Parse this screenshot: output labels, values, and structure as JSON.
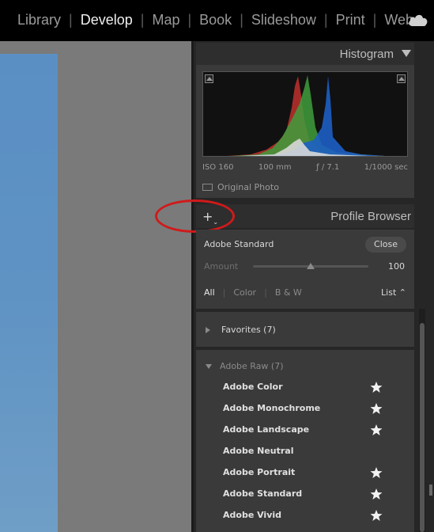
{
  "top_bar": {
    "modules": [
      {
        "label": "Library",
        "active": false
      },
      {
        "label": "Develop",
        "active": true
      },
      {
        "label": "Map",
        "active": false
      },
      {
        "label": "Book",
        "active": false
      },
      {
        "label": "Slideshow",
        "active": false
      },
      {
        "label": "Print",
        "active": false
      },
      {
        "label": "Web",
        "active": false
      }
    ],
    "cloud_icon": "cloud-icon"
  },
  "histogram": {
    "title": "Histogram",
    "iso": "ISO 160",
    "focal_length": "100 mm",
    "aperture": "ƒ / 7.1",
    "shutter": "1/1000 sec",
    "original_photo_label": "Original Photo"
  },
  "profile_browser": {
    "title": "Profile Browser",
    "add_icon": "plus-icon",
    "current_profile": "Adobe Standard",
    "close_label": "Close",
    "amount_label": "Amount",
    "amount_value": "100",
    "amount_fraction": 0.5,
    "filters": [
      "All",
      "Color",
      "B & W"
    ],
    "active_filter": "All",
    "view_mode": "List ⌃",
    "favorites_label": "Favorites (7)",
    "adobe_raw_label": "Adobe Raw (7)",
    "profiles": [
      {
        "name": "Adobe Color",
        "favorite": true
      },
      {
        "name": "Adobe Monochrome",
        "favorite": true
      },
      {
        "name": "Adobe Landscape",
        "favorite": true
      },
      {
        "name": "Adobe Neutral",
        "favorite": false
      },
      {
        "name": "Adobe Portrait",
        "favorite": true
      },
      {
        "name": "Adobe Standard",
        "favorite": true
      },
      {
        "name": "Adobe Vivid",
        "favorite": true
      }
    ]
  },
  "colors": {
    "annotation_ring": "#d01a1a",
    "histogram_red": "#c0302e",
    "histogram_green": "#3f9e3c",
    "histogram_blue": "#1d5fc4"
  }
}
